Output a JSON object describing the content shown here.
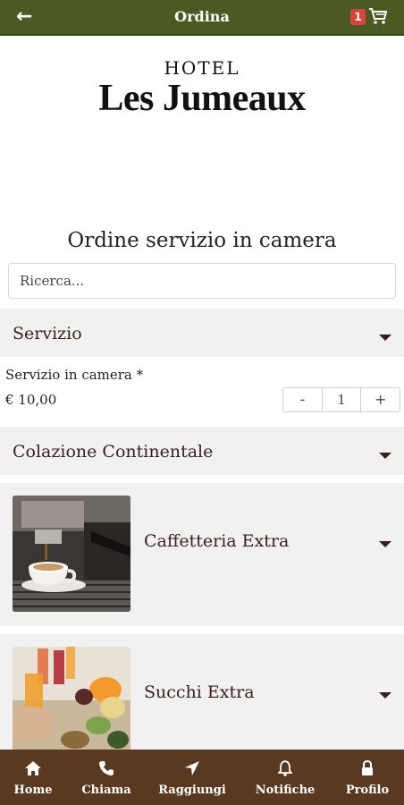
{
  "header": {
    "title": "Ordina",
    "cart_count": "1"
  },
  "logo": {
    "line1": "HOTEL",
    "line2": "Les Jumeaux"
  },
  "page": {
    "title": "Ordine servizio in camera"
  },
  "search": {
    "placeholder": "Ricerca..."
  },
  "sections": {
    "servizio": "Servizio",
    "colazione": "Colazione Continentale",
    "caffetteria": "Caffetteria Extra",
    "succhi": "Succhi Extra"
  },
  "item": {
    "name": "Servizio in camera *",
    "price": "€ 10,00",
    "qty": "1",
    "minus": "-",
    "plus": "+"
  },
  "nav": {
    "home": "Home",
    "chiama": "Chiama",
    "raggiungi": "Raggiungi",
    "notifiche": "Notifiche",
    "profilo": "Profilo"
  },
  "colors": {
    "topbar": "#4b5a23",
    "bottomnav": "#5a3921",
    "section_text": "#3b1f17",
    "badge": "#d9433b"
  }
}
